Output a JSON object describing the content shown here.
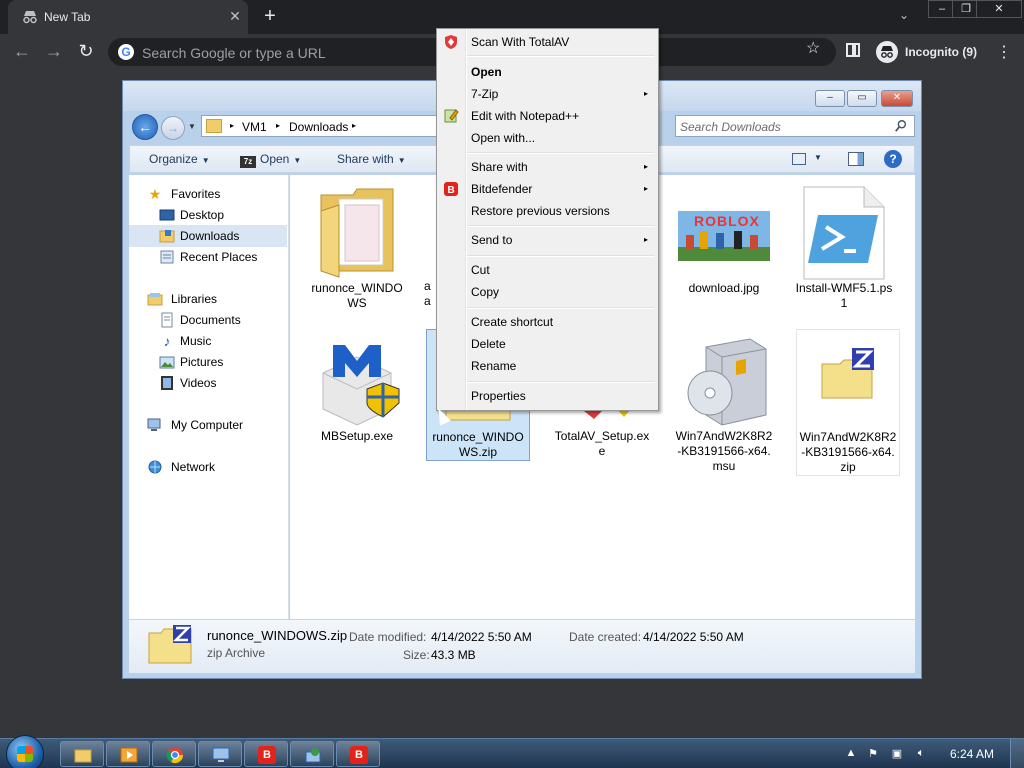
{
  "browser": {
    "tab_title": "New Tab",
    "tab_close": "✕",
    "new_tab": "+",
    "tab_search": "⌄",
    "omnibox_placeholder": "Search Google or type a URL",
    "omnibox_g": "G",
    "incognito_label": "Incognito (9)",
    "star": "☆",
    "menu": "⋮",
    "back": "←",
    "forward": "→",
    "reload": "↻",
    "win_minimize": "–",
    "win_restore": "❐",
    "win_close": "✕"
  },
  "explorer": {
    "breadcrumbs": [
      "VM1",
      "Downloads"
    ],
    "search_placeholder": "Search Downloads",
    "commands": {
      "organize": "Organize",
      "open": "Open",
      "open_badge": "7z",
      "share_with": "Share with"
    },
    "help": "?",
    "nav": {
      "favorites": "Favorites",
      "desktop": "Desktop",
      "downloads": "Downloads",
      "recent_places": "Recent Places",
      "libraries": "Libraries",
      "documents": "Documents",
      "music": "Music",
      "pictures": "Pictures",
      "videos": "Videos",
      "my_computer": "My Computer",
      "network": "Network"
    },
    "files": [
      {
        "name": "runonce_WINDOWS",
        "icon": "folder-icon"
      },
      {
        "name": "a a",
        "icon": "partial-file-icon"
      },
      {
        "name": "download.jpg",
        "icon": "image-icon",
        "thumb_text": "ROBLOX"
      },
      {
        "name": "Install-WMF5.1.ps1",
        "icon": "powershell-icon"
      },
      {
        "name": "MBSetup.exe",
        "icon": "malwarebytes-icon"
      },
      {
        "name": "runonce_WINDOWS.zip",
        "icon": "zip-icon"
      },
      {
        "name": "TotalAV_Setup.exe",
        "icon": "totalav-icon"
      },
      {
        "name": "Win7AndW2K8R2-KB3191566-x64.msu",
        "icon": "msu-icon"
      },
      {
        "name": "Win7AndW2K8R2-KB3191566-x64.zip",
        "icon": "zip-icon"
      }
    ],
    "details": {
      "name": "runonce_WINDOWS.zip",
      "type": "zip Archive",
      "date_modified_label": "Date modified:",
      "date_modified": "4/14/2022 5:50 AM",
      "date_created_label": "Date created:",
      "date_created": "4/14/2022 5:50 AM",
      "size_label": "Size:",
      "size": "43.3 MB"
    }
  },
  "context_menu": {
    "items": [
      {
        "label": "Scan With TotalAV",
        "icon": "totalav-shield-icon"
      },
      {
        "label": "Open",
        "bold": true
      },
      {
        "label": "7-Zip",
        "submenu": true
      },
      {
        "label": "Edit with Notepad++",
        "icon": "notepadpp-icon"
      },
      {
        "label": "Open with..."
      },
      {
        "label": "Share with",
        "submenu": true
      },
      {
        "label": "Bitdefender",
        "submenu": true,
        "icon": "bitdefender-icon"
      },
      {
        "label": "Restore previous versions"
      },
      {
        "label": "Send to",
        "submenu": true
      },
      {
        "label": "Cut"
      },
      {
        "label": "Copy"
      },
      {
        "label": "Create shortcut"
      },
      {
        "label": "Delete"
      },
      {
        "label": "Rename"
      },
      {
        "label": "Properties"
      }
    ],
    "submenu_arrow": "▸"
  },
  "taskbar": {
    "clock": "6:24 AM",
    "bitdefender_letter": "B"
  }
}
